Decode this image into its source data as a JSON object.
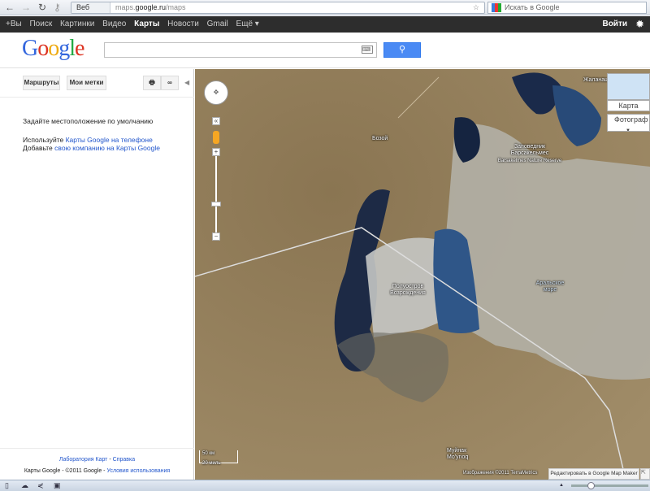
{
  "browser": {
    "web_label": "Веб",
    "url_prefix": "maps.",
    "url_domain": "google.ru",
    "url_path": "/maps",
    "search_placeholder": "Искать в Google"
  },
  "gbar": {
    "items": [
      "+Вы",
      "Поиск",
      "Картинки",
      "Видео",
      "Карты",
      "Новости",
      "Gmail",
      "Ещё ▾"
    ],
    "active": "Карты",
    "login": "Войти"
  },
  "header": {
    "logo": "Google",
    "search_value": "",
    "search_button_icon": "search-icon"
  },
  "left_panel": {
    "routes_button": "Маршруты",
    "my_places_button": "Мои метки",
    "set_location_link": "Задайте местоположение по умолчанию",
    "use_text": "Используйте",
    "use_link": "Карты Google на телефоне",
    "add_text": "Добавьте",
    "add_link": "свою компанию на Карты Google",
    "footer_labs": "Лаборатория Карт",
    "footer_sep": " - ",
    "footer_help": "Справка",
    "footer_copyright": "Карты Google - ©2011 Google - ",
    "footer_terms": "Условия использования"
  },
  "map": {
    "labels": {
      "bozoy": "Бозой",
      "reserve_ru": "Заповедник Барсакельмес",
      "reserve_en": "Barsakelmes Nature Reserve",
      "peninsula": "Полуостров Возрождения",
      "aral_sea": "Аральское море",
      "muynak_ru": "Муйнак",
      "muynak_en": "Mo'ynoq",
      "top_right": "Жаланаш"
    },
    "type_map": "Карта",
    "type_satellite": "Фотограф",
    "scale_km": "50 км",
    "scale_mi": "20 миль",
    "attribution": "Изображения ©2011 TerraMetrics",
    "edit_link": "Редактировать в Google Map Maker"
  }
}
